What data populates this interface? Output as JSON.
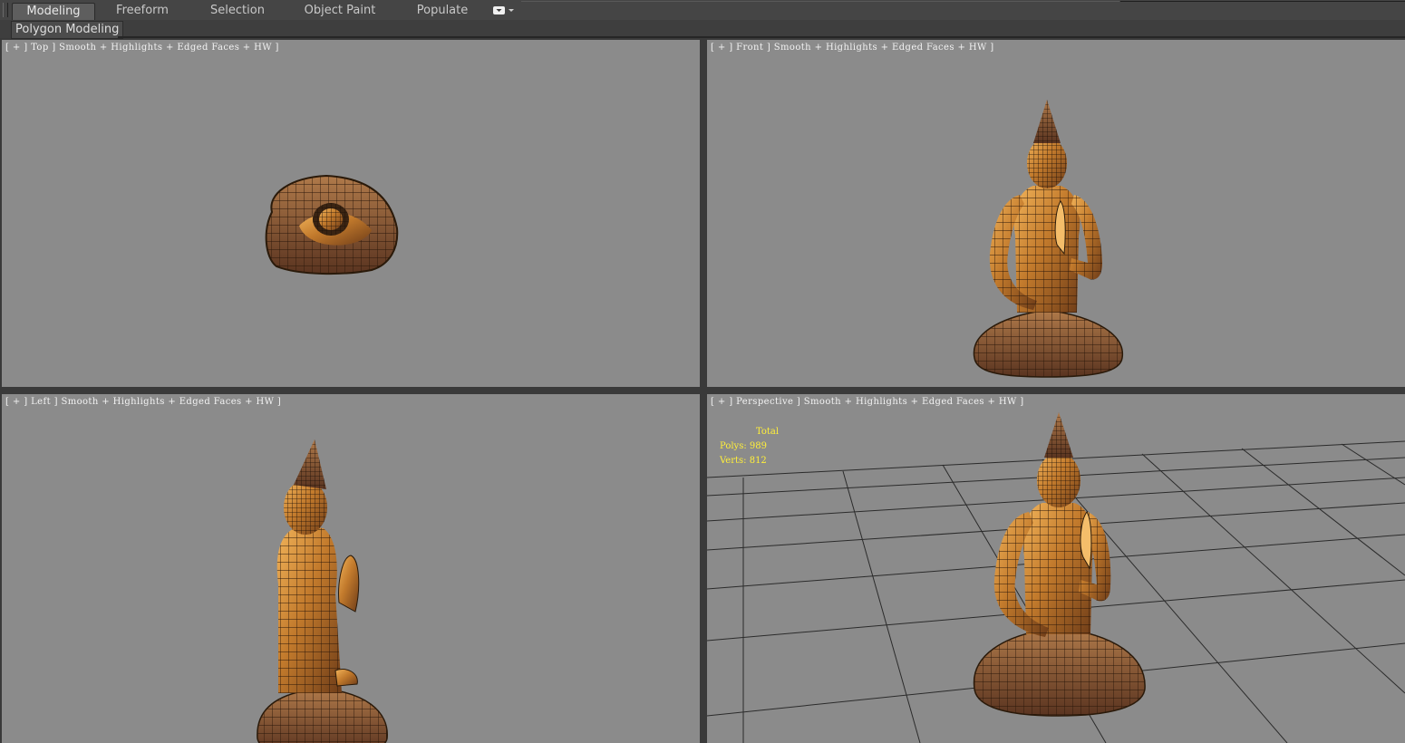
{
  "ribbon": {
    "tabs": [
      {
        "label": "Modeling",
        "active": true
      },
      {
        "label": "Freeform",
        "active": false
      },
      {
        "label": "Selection",
        "active": false
      },
      {
        "label": "Object Paint",
        "active": false
      },
      {
        "label": "Populate",
        "active": false
      }
    ],
    "dropdown_icon": "chevron-down-icon",
    "panel_label": "Polygon Modeling"
  },
  "viewports": {
    "top": {
      "label": "[ + ] Top ] Smooth + Highlights + Edged Faces + HW ]"
    },
    "front": {
      "label": "[ + ] Front ] Smooth + Highlights + Edged Faces + HW ]"
    },
    "left": {
      "label": "[ + ] Left ] Smooth + Highlights + Edged Faces + HW ]"
    },
    "perspective": {
      "label": "[ + ] Perspective ] Smooth + Highlights + Edged Faces + HW ]",
      "stats": {
        "title": "Total",
        "polys": "Polys: 989",
        "verts": "Verts: 812"
      }
    }
  },
  "colors": {
    "viewport_bg": "#8b8b8b",
    "stats_text": "#ffef3a",
    "model_gold": "#c98a3a",
    "wire": "#2a1a0a"
  }
}
